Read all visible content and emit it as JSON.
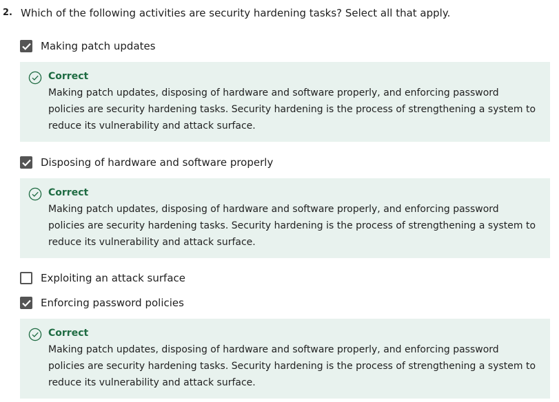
{
  "question": {
    "number": "2.",
    "text": "Which of the following activities are security hardening tasks? Select all that apply."
  },
  "options": [
    {
      "label": "Making patch updates",
      "checked": true,
      "feedback": {
        "status": "Correct",
        "text": "Making patch updates, disposing of hardware and software properly, and enforcing password policies are security hardening tasks. Security hardening is the process of strengthening a system to reduce its vulnerability and attack surface."
      }
    },
    {
      "label": "Disposing of hardware and software properly",
      "checked": true,
      "feedback": {
        "status": "Correct",
        "text": "Making patch updates, disposing of hardware and software properly, and enforcing password policies are security hardening tasks. Security hardening is the process of strengthening a system to reduce its vulnerability and attack surface."
      }
    },
    {
      "label": "Exploiting an attack surface",
      "checked": false
    },
    {
      "label": "Enforcing password policies",
      "checked": true,
      "feedback": {
        "status": "Correct",
        "text": "Making patch updates, disposing of hardware and software properly, and enforcing password policies are security hardening tasks. Security hardening is the process of strengthening a system to reduce its vulnerability and attack surface."
      }
    }
  ],
  "colors": {
    "checkbox": "#545454",
    "feedback_bg": "#e8f2ee",
    "correct_green": "#1e6b42"
  },
  "icons": {
    "checkmark": "checkmark-icon",
    "correct": "check-circle-icon"
  }
}
